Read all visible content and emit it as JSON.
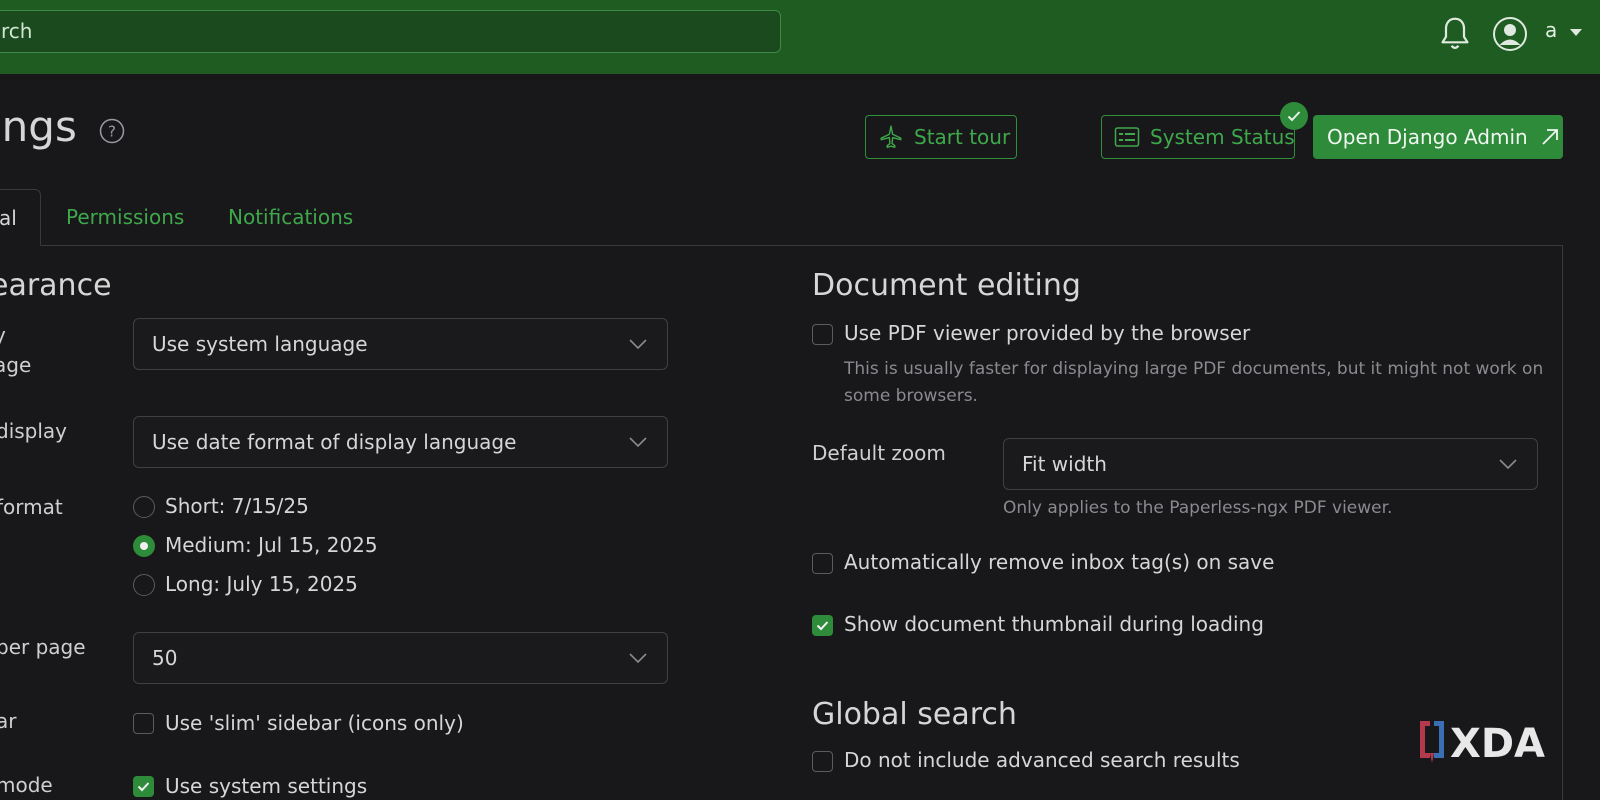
{
  "topbar": {
    "search_text": "rch",
    "username": "a"
  },
  "page": {
    "title": "ings"
  },
  "actions": {
    "start_tour": "Start tour",
    "system_status": "System Status",
    "open_admin": "Open Django Admin"
  },
  "tabs": {
    "active": "al",
    "permissions": "Permissions",
    "notifications": "Notifications"
  },
  "appearance": {
    "heading": "earance",
    "display_language_label_1": "y",
    "display_language_label_2": "age",
    "display_language_value": "Use system language",
    "date_display_label": "display",
    "date_display_value": "Use date format of display language",
    "date_format_label": "format",
    "date_format_options": [
      "Short: 7/15/25",
      "Medium: Jul 15, 2025",
      "Long: July 15, 2025"
    ],
    "date_format_selected": "Medium: Jul 15, 2025",
    "items_per_page_label": "per page",
    "items_per_page_value": "50",
    "sidebar_label": "ar",
    "sidebar_option": "Use 'slim' sidebar (icons only)",
    "sidebar_checked": false,
    "dark_mode_label": "mode",
    "dark_mode_option": "Use system settings",
    "dark_mode_checked": true
  },
  "document_editing": {
    "heading": "Document editing",
    "pdf_viewer_option": "Use PDF viewer provided by the browser",
    "pdf_viewer_checked": false,
    "pdf_viewer_hint_1": "This is usually faster for displaying large PDF documents, but it might not work on",
    "pdf_viewer_hint_2": "some browsers.",
    "default_zoom_label": "Default zoom",
    "default_zoom_value": "Fit width",
    "default_zoom_hint": "Only applies to the Paperless-ngx PDF viewer.",
    "remove_inbox_option": "Automatically remove inbox tag(s) on save",
    "remove_inbox_checked": false,
    "thumbnail_option": "Show document thumbnail during loading",
    "thumbnail_checked": true
  },
  "global_search": {
    "heading": "Global search",
    "advanced_option": "Do not include advanced search results",
    "advanced_checked": false
  },
  "watermark": {
    "text": "XDA"
  },
  "colors": {
    "topbar": "#1e5c22",
    "accent": "#2e8b3a",
    "background": "#18181b"
  }
}
